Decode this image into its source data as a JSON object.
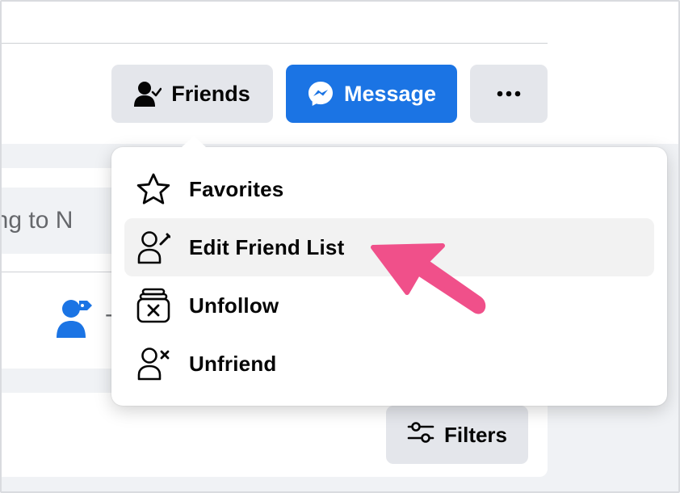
{
  "header": {
    "friends_button": {
      "label": "Friends",
      "icon": "friend-check-icon"
    },
    "message_button": {
      "label": "Message",
      "icon": "messenger-icon"
    },
    "more_button": {
      "icon": "more-dots-icon"
    }
  },
  "background": {
    "composer_placeholder": "thing to N",
    "tag_dash": "-",
    "filters_button": {
      "label": "Filters",
      "icon": "filters-icon"
    }
  },
  "friend_menu": {
    "items": [
      {
        "label": "Favorites",
        "icon": "star-icon"
      },
      {
        "label": "Edit Friend List",
        "icon": "edit-friend-list-icon",
        "highlighted": true
      },
      {
        "label": "Unfollow",
        "icon": "unfollow-icon"
      },
      {
        "label": "Unfriend",
        "icon": "unfriend-icon"
      }
    ]
  },
  "annotation": {
    "icon": "pointer-arrow-icon",
    "color": "#f0508a"
  },
  "colors": {
    "accent": "#1b74e4",
    "button_gray": "#e4e6eb",
    "page_bg": "#f0f2f5",
    "hover_bg": "#f2f2f2"
  }
}
